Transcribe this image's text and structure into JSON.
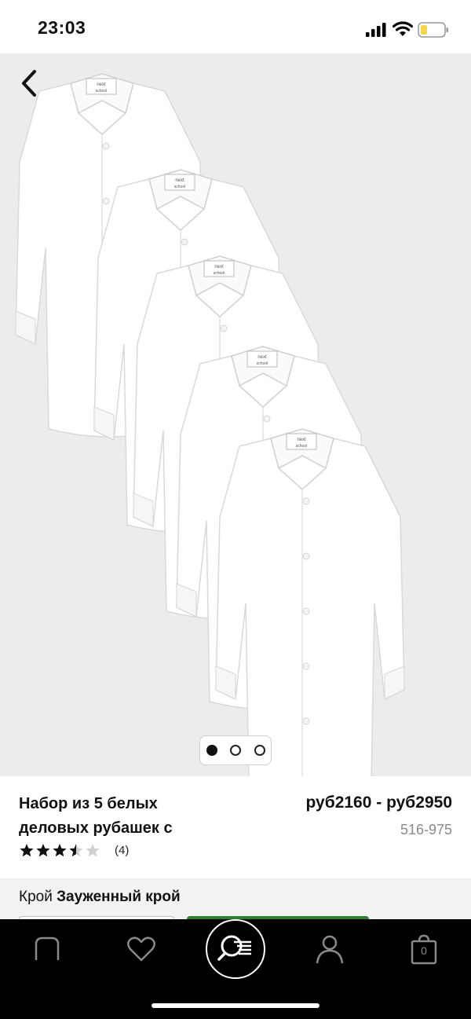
{
  "status_bar": {
    "time": "23:03",
    "icons": [
      "cellular-signal-icon",
      "wifi-icon",
      "battery-icon"
    ]
  },
  "gallery": {
    "back_icon": "chevron-left-icon",
    "pagination": {
      "count": 3,
      "active_index": 0
    },
    "labels": [
      "next",
      "school"
    ]
  },
  "product": {
    "title_line1": "Набор из 5 белых",
    "title_line2": "деловых рубашек с",
    "price": "руб2160 - руб2950",
    "code": "516-975",
    "rating": 3.5,
    "rating_max": 5,
    "review_count": "(4)"
  },
  "fit": {
    "label": "Крой",
    "value": "Зауженный крой"
  },
  "bottom_nav": {
    "items": [
      "home-icon",
      "heart-icon",
      "search-list-icon",
      "profile-icon",
      "bag-icon"
    ],
    "bag_count": "0"
  },
  "colors": {
    "image_bg": "#ececec",
    "nav_bg": "#000000",
    "accent_green": "#2f7d32",
    "battery_fill": "#f5d54a"
  }
}
